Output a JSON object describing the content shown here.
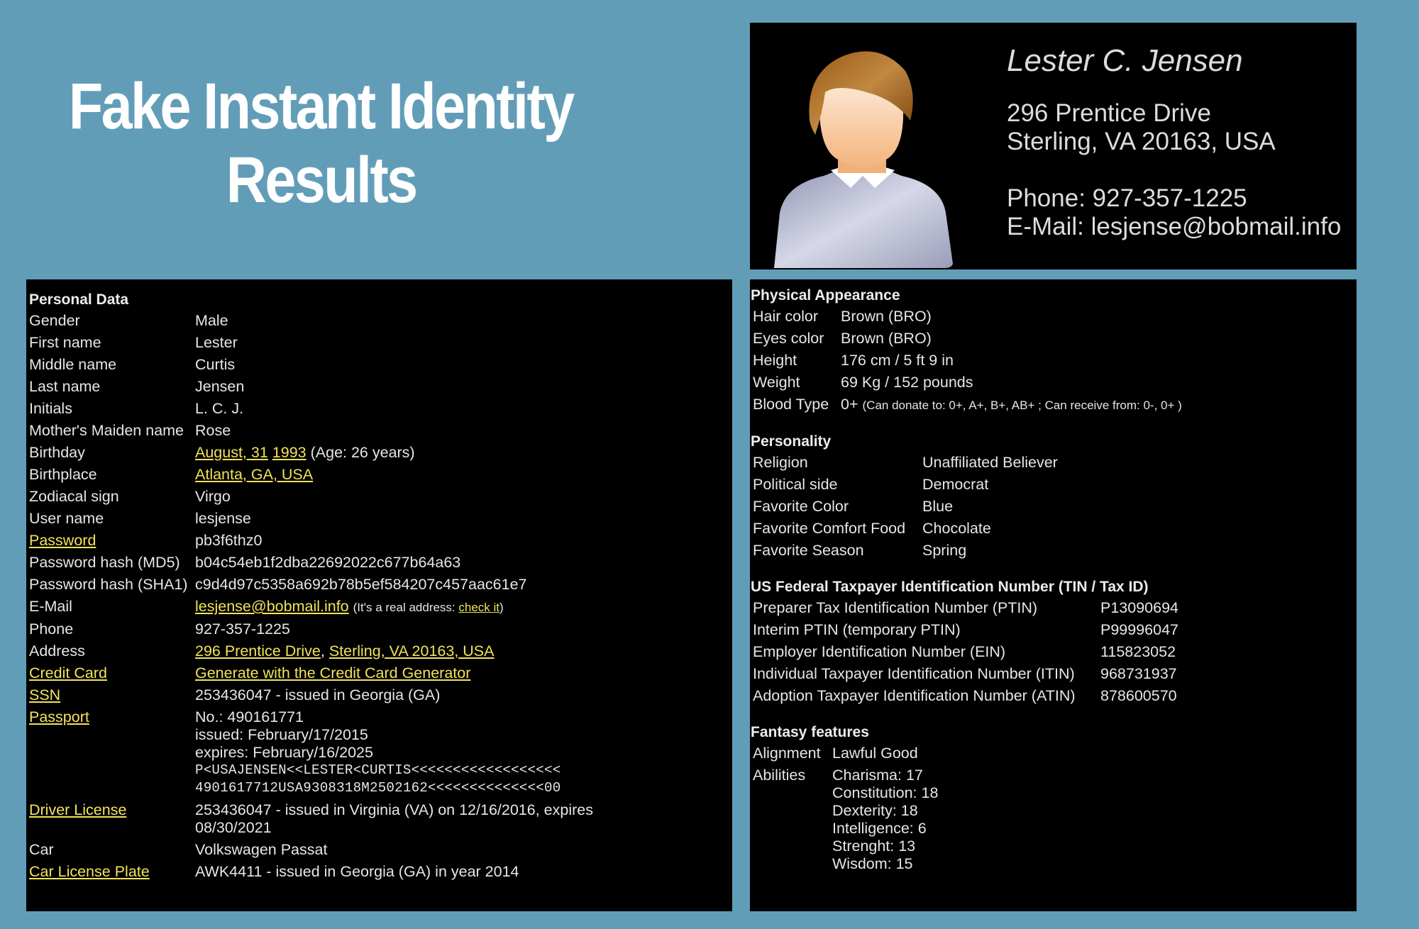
{
  "page": {
    "title_line1": "Fake Instant Identity",
    "title_line2": "Results",
    "background_color": "#629db8",
    "link_color": "#f2e35a"
  },
  "card": {
    "avatar_icon": "person-avatar-icon",
    "name": "Lester C. Jensen",
    "address_line1": "296 Prentice Drive",
    "address_line2": "Sterling, VA 20163, USA",
    "phone": "Phone: 927-357-1225",
    "email": "E-Mail: lesjense@bobmail.info"
  },
  "personal": {
    "heading": "Personal Data",
    "gender": {
      "label": "Gender",
      "value": "Male"
    },
    "first_name": {
      "label": "First name",
      "value": "Lester"
    },
    "middle_name": {
      "label": "Middle name",
      "value": "Curtis"
    },
    "last_name": {
      "label": "Last name",
      "value": "Jensen"
    },
    "initials": {
      "label": "Initials",
      "value": "L. C. J."
    },
    "maiden": {
      "label": "Mother's Maiden name",
      "value": "Rose"
    },
    "birthday": {
      "label": "Birthday",
      "date_link": "August, 31",
      "year_link": "1993",
      "age": "(Age: 26 years)"
    },
    "birthplace": {
      "label": "Birthplace",
      "value_link": "Atlanta, GA, USA"
    },
    "zodiac": {
      "label": "Zodiacal sign",
      "value": "Virgo"
    },
    "username": {
      "label": "User name",
      "value": "lesjense"
    },
    "password": {
      "label_link": "Password",
      "value": "pb3f6thz0"
    },
    "md5": {
      "label": "Password hash (MD5)",
      "value": "b04c54eb1f2dba22692022c677b64a63"
    },
    "sha1": {
      "label": "Password hash (SHA1)",
      "value": "c9d4d97c5358a692b78b5ef584207c457aac61e7"
    },
    "email": {
      "label": "E-Mail",
      "value_link": "lesjense@bobmail.info",
      "note_prefix": "(It's a real address: ",
      "note_link": "check it",
      "note_suffix": ")"
    },
    "phone": {
      "label": "Phone",
      "value": "927-357-1225"
    },
    "address": {
      "label": "Address",
      "street_link": "296 Prentice Drive",
      "separator": ", ",
      "city_link": "Sterling, VA 20163, USA"
    },
    "credit_card": {
      "label_link": "Credit Card",
      "value_link": "Generate with the Credit Card Generator"
    },
    "ssn": {
      "label_link": "SSN",
      "value": "253436047 - issued in Georgia (GA)"
    },
    "passport": {
      "label_link": "Passport",
      "number": "No.: 490161771",
      "issued": "issued: February/17/2015",
      "expires": "expires: February/16/2025",
      "mrz1": "P<USAJENSEN<<LESTER<CURTIS<<<<<<<<<<<<<<<<<<",
      "mrz2": "4901617712USA9308318M2502162<<<<<<<<<<<<<<00"
    },
    "driver_license": {
      "label_link": "Driver License",
      "value": "253436047 - issued in Virginia (VA) on 12/16/2016, expires 08/30/2021"
    },
    "car": {
      "label": "Car",
      "value": "Volkswagen Passat"
    },
    "plate": {
      "label_link": "Car License Plate",
      "value": "AWK4411 - issued in Georgia (GA) in year 2014"
    }
  },
  "physical": {
    "heading": "Physical Appearance",
    "rows": [
      {
        "label": "Hair color",
        "value": "Brown (BRO)"
      },
      {
        "label": "Eyes color",
        "value": "Brown (BRO)"
      },
      {
        "label": "Height",
        "value": "176 cm / 5 ft 9 in"
      },
      {
        "label": "Weight",
        "value": "69 Kg / 152 pounds"
      }
    ],
    "blood": {
      "label": "Blood Type",
      "value": "0+",
      "note": "(Can donate to: 0+, A+, B+, AB+ ; Can receive from: 0-, 0+ )"
    }
  },
  "personality": {
    "heading": "Personality",
    "rows": [
      {
        "label": "Religion",
        "value": "Unaffiliated Believer"
      },
      {
        "label": "Political side",
        "value": "Democrat"
      },
      {
        "label": "Favorite Color",
        "value": "Blue"
      },
      {
        "label": "Favorite Comfort Food",
        "value": "Chocolate"
      },
      {
        "label": "Favorite Season",
        "value": "Spring"
      }
    ]
  },
  "tin": {
    "heading": "US Federal Taxpayer Identification Number (TIN / Tax ID)",
    "rows": [
      {
        "label": "Preparer Tax Identification Number (PTIN)",
        "value": "P13090694"
      },
      {
        "label": "Interim PTIN (temporary PTIN)",
        "value": "P99996047"
      },
      {
        "label": "Employer Identification Number (EIN)",
        "value": "115823052"
      },
      {
        "label": "Individual Taxpayer Identification Number (ITIN)",
        "value": "968731937"
      },
      {
        "label": "Adoption Taxpayer Identification Number (ATIN)",
        "value": "878600570"
      }
    ]
  },
  "fantasy": {
    "heading": "Fantasy features",
    "alignment": {
      "label": "Alignment",
      "value": "Lawful Good"
    },
    "abilities_label": "Abilities",
    "abilities": [
      "Charisma: 17",
      "Constitution: 18",
      "Dexterity: 18",
      "Intelligence: 6",
      "Strenght: 13",
      "Wisdom: 15"
    ]
  }
}
